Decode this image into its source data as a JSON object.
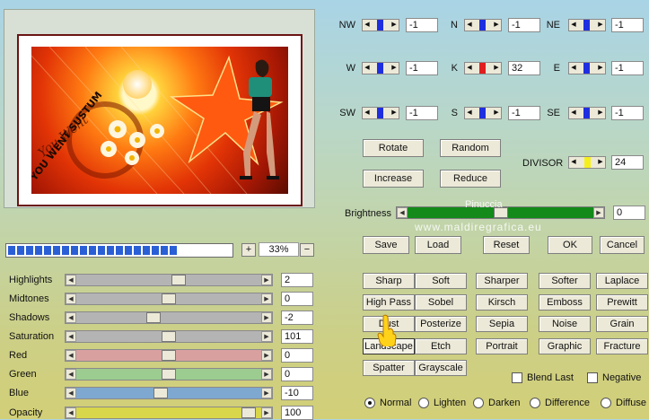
{
  "preview": {
    "art_text": {
      "primary": "YOU WENT SUSTUM",
      "script": "You Went"
    },
    "image_subject": "woman-in-green-top-with-flowers-and-star"
  },
  "zoom": {
    "value": "33%",
    "plus": "+",
    "minus": "−",
    "segments": 19
  },
  "sliders": [
    {
      "label": "Highlights",
      "value": "2",
      "pos": 0.56,
      "color": "#b4b4b4"
    },
    {
      "label": "Midtones",
      "value": "0",
      "pos": 0.5,
      "color": "#b4b4b4"
    },
    {
      "label": "Shadows",
      "value": "-2",
      "pos": 0.41,
      "color": "#b4b4b4"
    },
    {
      "label": "Saturation",
      "value": "101",
      "pos": 0.5,
      "color": "#b4b4b4"
    },
    {
      "label": "Red",
      "value": "0",
      "pos": 0.5,
      "color": "#d9a0a0"
    },
    {
      "label": "Green",
      "value": "0",
      "pos": 0.5,
      "color": "#9ccc8f"
    },
    {
      "label": "Blue",
      "value": "-10",
      "pos": 0.45,
      "color": "#7ea8d0"
    },
    {
      "label": "Opacity",
      "value": "100",
      "pos": 0.97,
      "color": "#d8d64a"
    }
  ],
  "directions": [
    {
      "label": "NW",
      "value": "-1",
      "red": false
    },
    {
      "label": "N",
      "value": "-1",
      "red": false
    },
    {
      "label": "NE",
      "value": "-1",
      "red": false
    },
    {
      "label": "W",
      "value": "-1",
      "red": false
    },
    {
      "label": "K",
      "value": "32",
      "red": true
    },
    {
      "label": "E",
      "value": "-1",
      "red": false
    },
    {
      "label": "SW",
      "value": "-1",
      "red": false
    },
    {
      "label": "S",
      "value": "-1",
      "red": false
    },
    {
      "label": "SE",
      "value": "-1",
      "red": false
    }
  ],
  "matrix_buttons": {
    "rotate": "Rotate",
    "random": "Random",
    "increase": "Increase",
    "reduce": "Reduce"
  },
  "divisor": {
    "label": "DIVISOR",
    "value": "24"
  },
  "brightness": {
    "label": "Brightness",
    "value": "0",
    "watermark_1": "Pinuccia",
    "watermark_2": "www.maldiregrafica.eu"
  },
  "actions": {
    "save": "Save",
    "load": "Load",
    "reset": "Reset",
    "ok": "OK",
    "cancel": "Cancel"
  },
  "filters": [
    [
      "Sharp",
      "Soft",
      "Sharper",
      "Softer",
      "Laplace"
    ],
    [
      "High Pass",
      "Sobel",
      "Kirsch",
      "Emboss",
      "Prewitt"
    ],
    [
      "Dust",
      "Posterize",
      "Sepia",
      "Noise",
      "Grain"
    ],
    [
      "Landscape",
      "Etch",
      "Portrait",
      "Graphic",
      "Fracture"
    ],
    [
      "Spatter",
      "Grayscale"
    ]
  ],
  "selected_filter": "Landscape",
  "checkboxes": {
    "blend_last": "Blend Last",
    "negative": "Negative"
  },
  "blend_modes": [
    "Normal",
    "Lighten",
    "Darken",
    "Difference",
    "Diffuse"
  ],
  "selected_blend": "Normal"
}
